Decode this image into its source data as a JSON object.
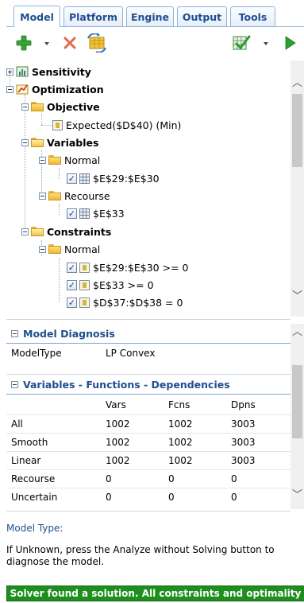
{
  "tabs": [
    {
      "label": "Model",
      "active": true
    },
    {
      "label": "Platform",
      "active": false
    },
    {
      "label": "Engine",
      "active": false
    },
    {
      "label": "Output",
      "active": false
    },
    {
      "label": "Tools",
      "active": false
    }
  ],
  "toolbar": {
    "icons": [
      "add-icon",
      "delete-icon",
      "refresh-icon",
      "analyze-icon",
      "solve-icon"
    ],
    "colors": {
      "add": "#3aa336",
      "delete": "#e06a50",
      "solve": "#2ea02e"
    }
  },
  "tree": {
    "sensitivity": "Sensitivity",
    "optimization": "Optimization",
    "objective": "Objective",
    "objective_item": "Expected($D$40) (Min)",
    "variables": "Variables",
    "var_normal": "Normal",
    "var_normal_item": "$E$29:$E$30",
    "var_recourse": "Recourse",
    "var_recourse_item": "$E$33",
    "constraints": "Constraints",
    "con_normal": "Normal",
    "con_items": [
      "$E$29:$E$30 >= 0",
      "$E$33 >= 0",
      "$D$37:$D$38 = 0"
    ]
  },
  "diagnosis": {
    "title": "Model Diagnosis",
    "model_type_label": "ModelType",
    "model_type_value": "LP Convex",
    "vfd_title": "Variables - Functions - Dependencies",
    "columns": [
      "Vars",
      "Fcns",
      "Dpns"
    ],
    "rows": [
      {
        "label": "All",
        "values": [
          "1002",
          "1002",
          "3003"
        ]
      },
      {
        "label": "Smooth",
        "values": [
          "1002",
          "1002",
          "3003"
        ]
      },
      {
        "label": "Linear",
        "values": [
          "1002",
          "1002",
          "3003"
        ]
      },
      {
        "label": "Recourse",
        "values": [
          "0",
          "0",
          "0"
        ]
      },
      {
        "label": "Uncertain",
        "values": [
          "0",
          "0",
          "0"
        ]
      }
    ]
  },
  "info": {
    "title": "Model Type:",
    "text": "If Unknown, press the Analyze without Solving button to diagnose the model."
  },
  "status": {
    "text": "Solver found a solution. All constraints and optimality",
    "color": "#1e8f1e"
  }
}
